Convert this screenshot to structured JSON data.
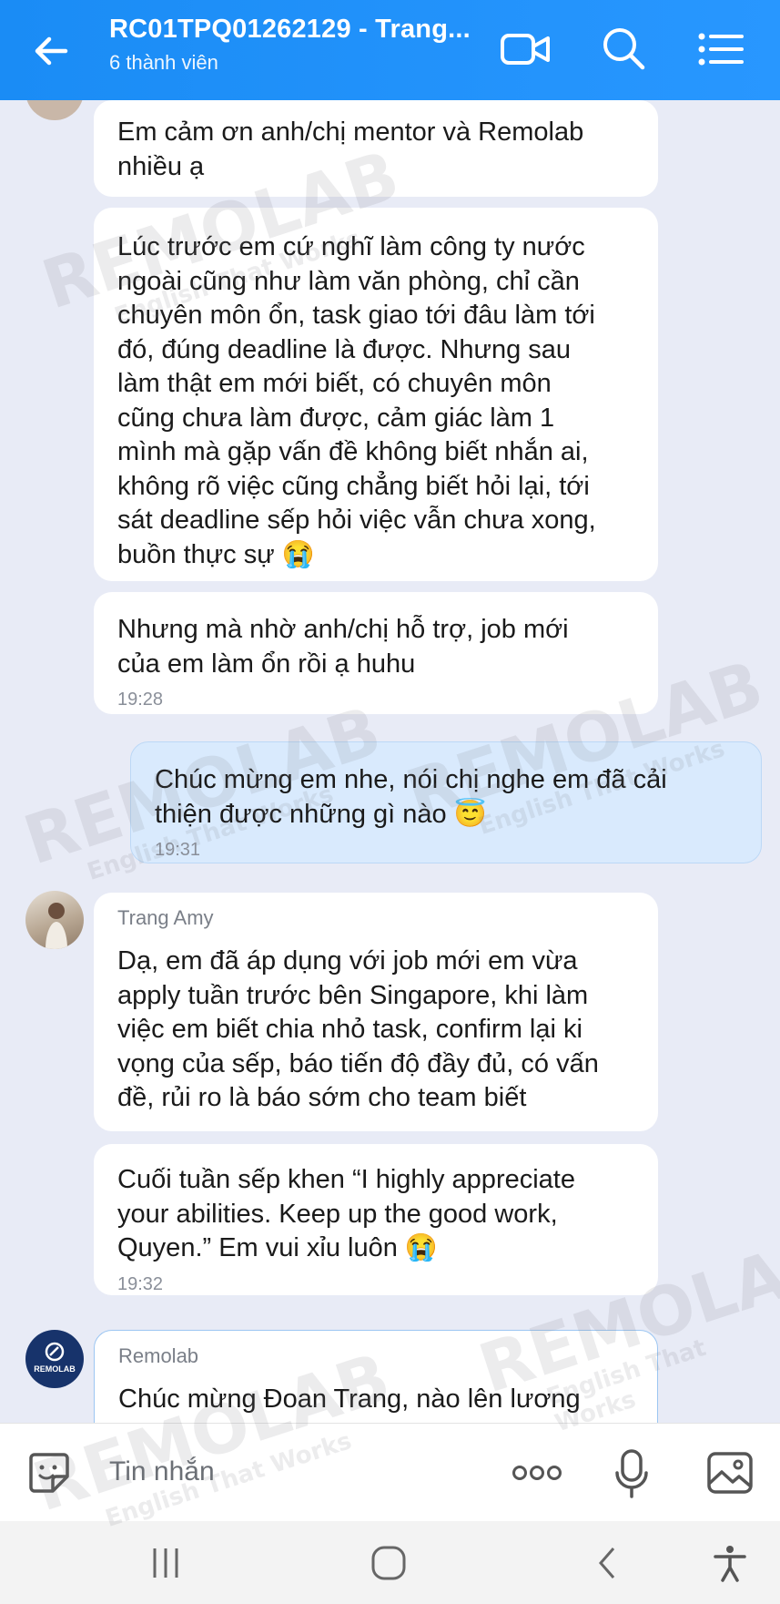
{
  "header": {
    "title": "RC01TPQ01262129 - Trang...",
    "subtitle": "6 thành viên",
    "icons": [
      "back-arrow-icon",
      "video-call-icon",
      "search-icon",
      "menu-list-icon"
    ]
  },
  "messages": [
    {
      "text": "Em cảm ơn anh/chị mentor và Remolab\nnhiều ạ"
    },
    {
      "text": "Lúc trước em cứ nghĩ làm công ty nước\nngoài cũng như làm văn phòng, chỉ cần\nchuyên môn ổn, task giao tới đâu làm tới\nđó, đúng deadline là được. Nhưng sau\nlàm thật em mới biết, có chuyên môn\ncũng chưa làm được, cảm giác làm 1\nmình mà gặp vấn đề không biết nhắn ai,\nkhông rõ việc cũng chẳng biết hỏi lại, tới\nsát deadline sếp hỏi việc vẫn chưa xong,\nbuồn thực sự 😭"
    },
    {
      "text": "Nhưng mà nhờ anh/chị hỗ trợ, job mới\ncủa em làm ổn rồi ạ huhu",
      "time": "19:28"
    },
    {
      "text": "Chúc mừng em nhe, nói chị nghe em đã cải\nthiện được những gì nào 😇",
      "time": "19:31"
    },
    {
      "sender": "Trang Amy",
      "text": "Dạ, em đã áp dụng với job mới em vừa\napply tuần trước bên Singapore, khi làm\nviệc em biết chia nhỏ task, confirm lại ki\nvọng của sếp, báo tiến độ đầy đủ, có vấn\nđề, rủi ro là báo sớm cho team biết"
    },
    {
      "text": "Cuối tuần sếp khen “I highly appreciate\nyour abilities. Keep up the good work,\nQuyen.” Em vui xỉu luôn 😭",
      "time": "19:32"
    },
    {
      "sender": "Remolab",
      "text": "Chúc mừng Đoan Trang, nào lên lương"
    }
  ],
  "avatars": {
    "remolab_logo_text": "REMOLAB"
  },
  "input": {
    "placeholder": "Tin nhắn"
  },
  "watermark": {
    "brand": "REMOLAB",
    "tagline": "English That Works"
  },
  "colors": {
    "header": "#1e90ff",
    "chat_bg": "#e8ebf6",
    "my_bubble": "#d9eafd"
  }
}
